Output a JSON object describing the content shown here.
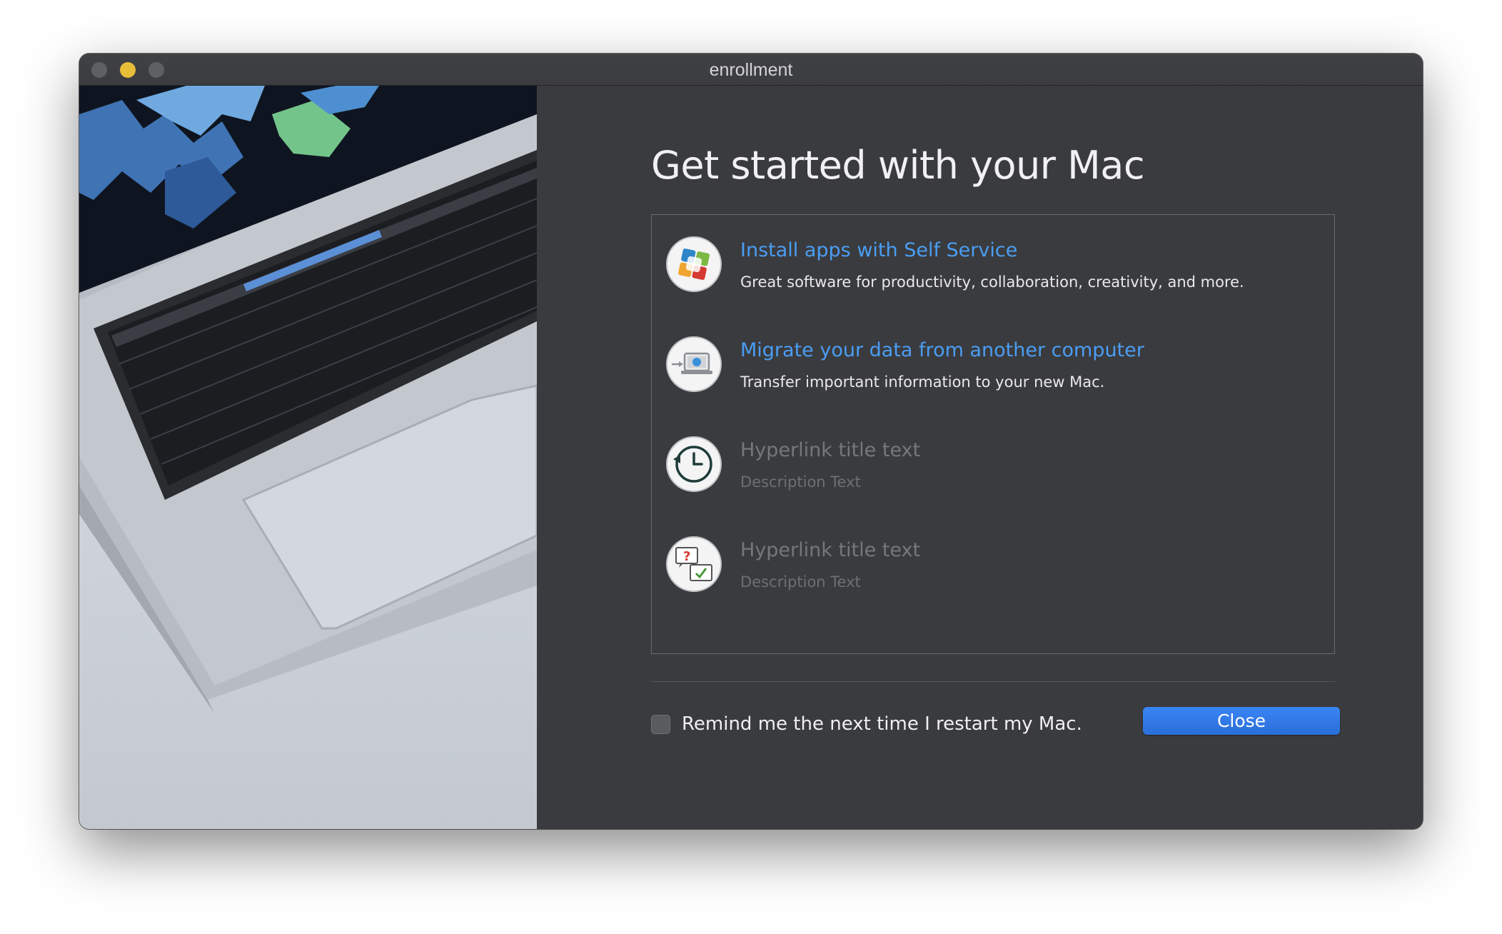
{
  "window": {
    "title": "enrollment"
  },
  "main": {
    "heading": "Get started with your Mac",
    "items": [
      {
        "icon": "self-service-icon",
        "title": "Install apps with Self Service",
        "description": "Great software for productivity, collaboration, creativity, and more.",
        "enabled": true
      },
      {
        "icon": "migration-laptop-icon",
        "title": "Migrate your data from another computer",
        "description": "Transfer important information to your new Mac.",
        "enabled": true
      },
      {
        "icon": "time-machine-clock-icon",
        "title": "Hyperlink title text",
        "description": "Description Text",
        "enabled": false
      },
      {
        "icon": "help-chat-icon",
        "title": "Hyperlink title text",
        "description": "Description Text",
        "enabled": false
      }
    ]
  },
  "footer": {
    "remind_label": "Remind me the next time I restart my Mac.",
    "remind_checked": false,
    "close_label": "Close"
  },
  "colors": {
    "link": "#4a9df3",
    "disabled": "#76777b",
    "button": "#2f78e6",
    "background": "#3a3b3e"
  }
}
